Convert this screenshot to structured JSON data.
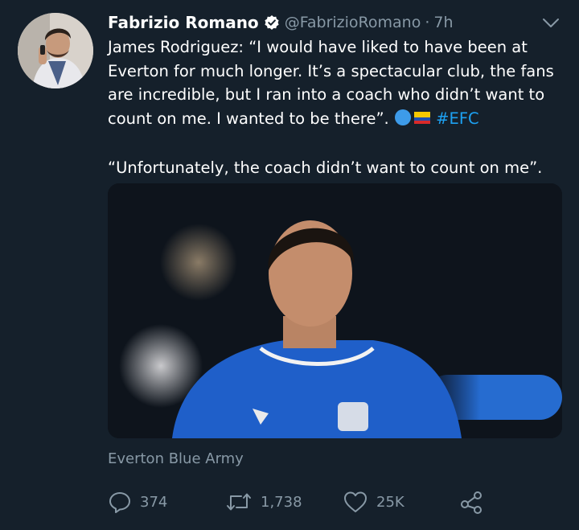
{
  "tweet": {
    "author_name": "Fabrizio Romano",
    "handle": "@FabrizioRomano",
    "separator": "·",
    "time": "7h",
    "text_line1": "James Rodriguez: “I would have liked to have been at Everton for much longer. It’s a spectacular club, the fans are incredible, but I ran into a coach who didn’t want to count on me. I wanted to be there”.",
    "hashtag": "#EFC",
    "text_line2": "“Unfortunately, the coach didn’t want to count on me”.",
    "source": "Everton Blue Army"
  },
  "actions": {
    "replies": "374",
    "retweets": "1,738",
    "likes": "25K"
  },
  "icons": {
    "verified": "verified-badge-icon",
    "menu": "chevron-down-icon",
    "reply": "reply-icon",
    "retweet": "retweet-icon",
    "like": "heart-icon",
    "share": "share-icon"
  },
  "colors": {
    "background": "#15202b",
    "text": "#ffffff",
    "muted": "#8899a6",
    "accent": "#1da1f2",
    "shirt": "#1f5fc9"
  }
}
